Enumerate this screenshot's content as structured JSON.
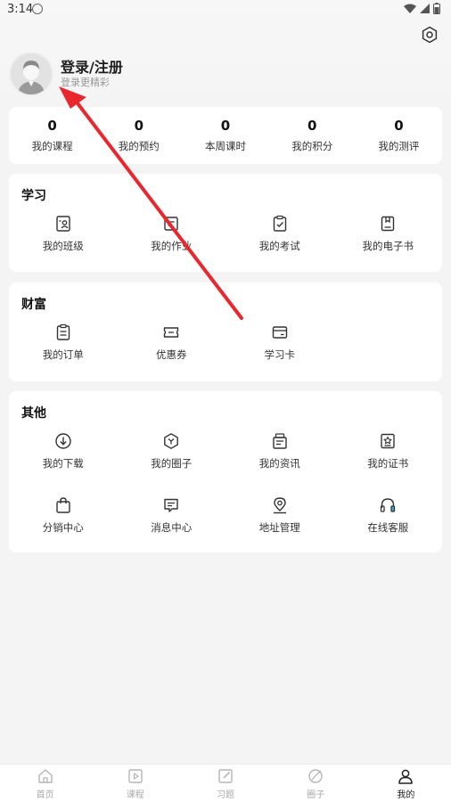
{
  "status_bar": {
    "time": "3:14"
  },
  "profile": {
    "title": "登录/注册",
    "subtitle": "登录更精彩"
  },
  "stats": [
    {
      "value": "0",
      "label": "我的课程"
    },
    {
      "value": "0",
      "label": "我的预约"
    },
    {
      "value": "0",
      "label": "本周课时"
    },
    {
      "value": "0",
      "label": "我的积分"
    },
    {
      "value": "0",
      "label": "我的测评"
    }
  ],
  "learning": {
    "title": "学习",
    "items": [
      {
        "label": "我的班级",
        "icon": "class-icon"
      },
      {
        "label": "我的作业",
        "icon": "homework-icon"
      },
      {
        "label": "我的考试",
        "icon": "exam-icon"
      },
      {
        "label": "我的电子书",
        "icon": "ebook-icon"
      }
    ]
  },
  "wealth": {
    "title": "财富",
    "items": [
      {
        "label": "我的订单",
        "icon": "order-icon"
      },
      {
        "label": "优惠券",
        "icon": "coupon-icon"
      },
      {
        "label": "学习卡",
        "icon": "card-icon"
      }
    ]
  },
  "other": {
    "title": "其他",
    "items": [
      {
        "label": "我的下载",
        "icon": "download-icon"
      },
      {
        "label": "我的圈子",
        "icon": "circle-icon"
      },
      {
        "label": "我的资讯",
        "icon": "news-icon"
      },
      {
        "label": "我的证书",
        "icon": "certificate-icon"
      },
      {
        "label": "分销中心",
        "icon": "bag-icon"
      },
      {
        "label": "消息中心",
        "icon": "message-icon"
      },
      {
        "label": "地址管理",
        "icon": "location-icon"
      },
      {
        "label": "在线客服",
        "icon": "headset-icon"
      }
    ]
  },
  "tabs": [
    {
      "label": "首页",
      "icon": "home-icon"
    },
    {
      "label": "课程",
      "icon": "course-icon"
    },
    {
      "label": "习题",
      "icon": "exercise-icon"
    },
    {
      "label": "圈子",
      "icon": "circle-tab-icon"
    },
    {
      "label": "我的",
      "icon": "person-icon",
      "active": true
    }
  ],
  "colors": {
    "annotation_arrow": "#e8282e",
    "active_tab": "#222222",
    "inactive_tab": "#aaaaaa"
  }
}
